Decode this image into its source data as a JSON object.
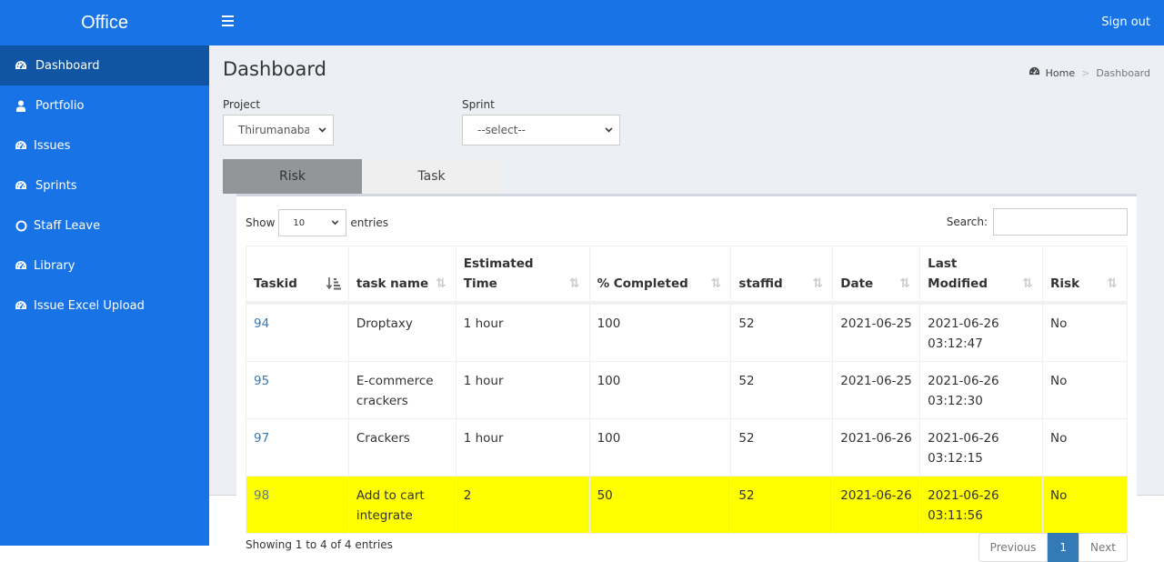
{
  "header": {
    "brand": "Office",
    "menu_icon": "hamburger-icon",
    "signout_label": "Sign out"
  },
  "sidebar": {
    "items": [
      {
        "label": "Dashboard",
        "icon": "dashboard-icon",
        "active": true
      },
      {
        "label": "Portfolio",
        "icon": "user-icon"
      },
      {
        "label": "Issues",
        "icon": "dashboard-icon"
      },
      {
        "label": "Sprints",
        "icon": "dashboard-icon"
      },
      {
        "label": "Staff Leave",
        "icon": "circle-icon"
      },
      {
        "label": "Library",
        "icon": "dashboard-icon"
      },
      {
        "label": "Issue Excel Upload",
        "icon": "dashboard-icon"
      }
    ]
  },
  "page": {
    "title": "Dashboard",
    "breadcrumb": {
      "home": "Home",
      "separator": ">",
      "current": "Dashboard"
    }
  },
  "filters": {
    "project_label": "Project",
    "project_value": "Thirumanaba",
    "sprint_label": "Sprint",
    "sprint_value": "--select--"
  },
  "tabs": [
    {
      "label": "Risk",
      "active": true
    },
    {
      "label": "Task",
      "active": false
    }
  ],
  "table_controls": {
    "show_label": "Show",
    "page_length": "10",
    "entries_label": "entries",
    "search_label": "Search:",
    "search_value": ""
  },
  "table": {
    "columns": [
      "Taskid",
      "task name",
      "Estimated Time",
      "% Completed",
      "staffid",
      "Date",
      "Last Modified",
      "Risk"
    ],
    "rows": [
      {
        "taskid": "94",
        "task_name": "Droptaxy",
        "estimated_time": "1 hour",
        "completed": "100",
        "staffid": "52",
        "date": "2021-06-25",
        "last_modified": "2021-06-26 03:12:47",
        "risk": "No",
        "highlight": false
      },
      {
        "taskid": "95",
        "task_name": "E-commerce crackers",
        "estimated_time": "1 hour",
        "completed": "100",
        "staffid": "52",
        "date": "2021-06-25",
        "last_modified": "2021-06-26 03:12:30",
        "risk": "No",
        "highlight": false
      },
      {
        "taskid": "97",
        "task_name": "Crackers",
        "estimated_time": "1 hour",
        "completed": "100",
        "staffid": "52",
        "date": "2021-06-26",
        "last_modified": "2021-06-26 03:12:15",
        "risk": "No",
        "highlight": false
      },
      {
        "taskid": "98",
        "task_name": "Add to cart integrate",
        "estimated_time": "2",
        "completed": "50",
        "staffid": "52",
        "date": "2021-06-26",
        "last_modified": "2021-06-26 03:11:56",
        "risk": "No",
        "highlight": true
      }
    ],
    "highlight_color": "#ffff00"
  },
  "footer": {
    "info": "Showing 1 to 4 of 4 entries",
    "previous": "Previous",
    "current_page": "1",
    "next": "Next"
  },
  "colors": {
    "primary": "#1773e6",
    "sidebar_active": "#0f55a3",
    "content_bg": "#ecf0f5",
    "link": "#337ab7"
  }
}
